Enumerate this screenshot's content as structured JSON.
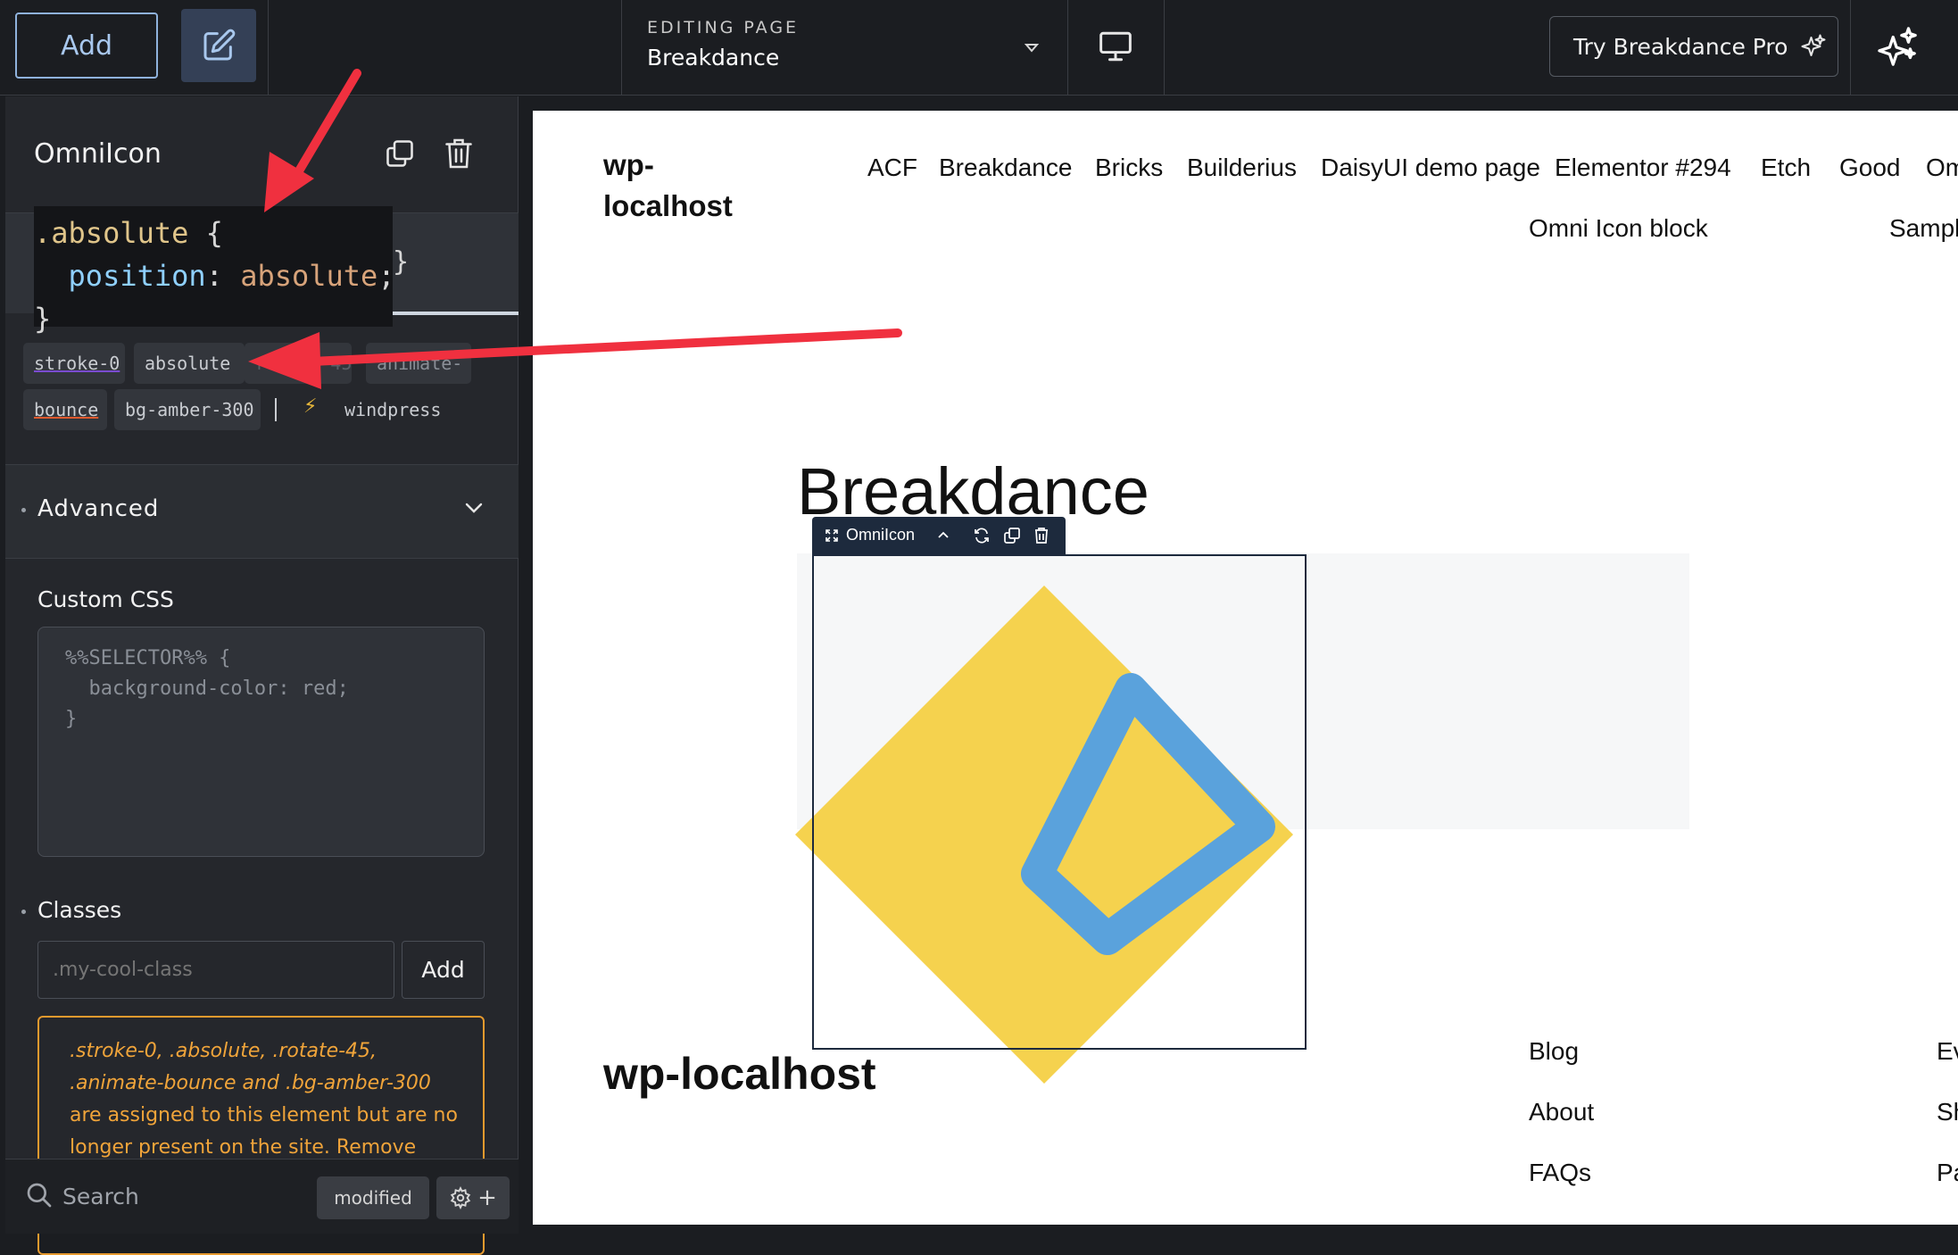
{
  "topbar": {
    "add_label": "Add",
    "editing_label": "EDITING PAGE",
    "editing_page": "Breakdance",
    "try_pro_label": "Try Breakdance Pro"
  },
  "panel": {
    "element_title": "OmniIcon",
    "code_tooltip": {
      "selector": ".absolute",
      "open_brace": "{",
      "property": "position",
      "value": "absolute",
      "close_brace": "}",
      "tail": "}"
    },
    "class_chips": [
      "stroke-0",
      "absolute",
      "rotate-45",
      "animate-",
      "bounce",
      "bg-amber-300"
    ],
    "windpress_label": "windpress",
    "advanced_label": "Advanced",
    "custom_css_label": "Custom CSS",
    "custom_css_placeholder": "%%SELECTOR%% {\n  background-color: red;\n}",
    "classes_label": "Classes",
    "class_input_placeholder": ".my-cool-class",
    "class_add_label": "Add",
    "warning": {
      "classes_text": ".stroke-0, .absolute, .rotate-45, .animate-bounce and .bg-amber-300",
      "message": "are assigned to this element but are no longer present on the site. Remove"
    },
    "search_label": "Search",
    "modified_label": "modified"
  },
  "canvas": {
    "site_logo": "wp-\nlocalhost",
    "nav_items_row1": [
      "ACF",
      "Breakdance",
      "Bricks",
      "Builderius",
      "DaisyUI demo page",
      "Elementor #294",
      "Etch",
      "Good",
      "Om"
    ],
    "nav_items_row2": [
      "Omni Icon block",
      "Sampl"
    ],
    "page_heading": "Breakdance",
    "toolbar_label": "OmniIcon",
    "footer_logo": "wp-localhost",
    "footer_col1": [
      "Blog",
      "About",
      "FAQs"
    ],
    "footer_col2": [
      "Ev",
      "Sh",
      "Pa"
    ]
  },
  "colors": {
    "accent_blue": "#8fb2dc",
    "warning_orange": "#e79a2e",
    "icon_yellow": "#f5d24e",
    "icon_blue": "#5aa2dc",
    "arrow_red": "#f0303f"
  }
}
